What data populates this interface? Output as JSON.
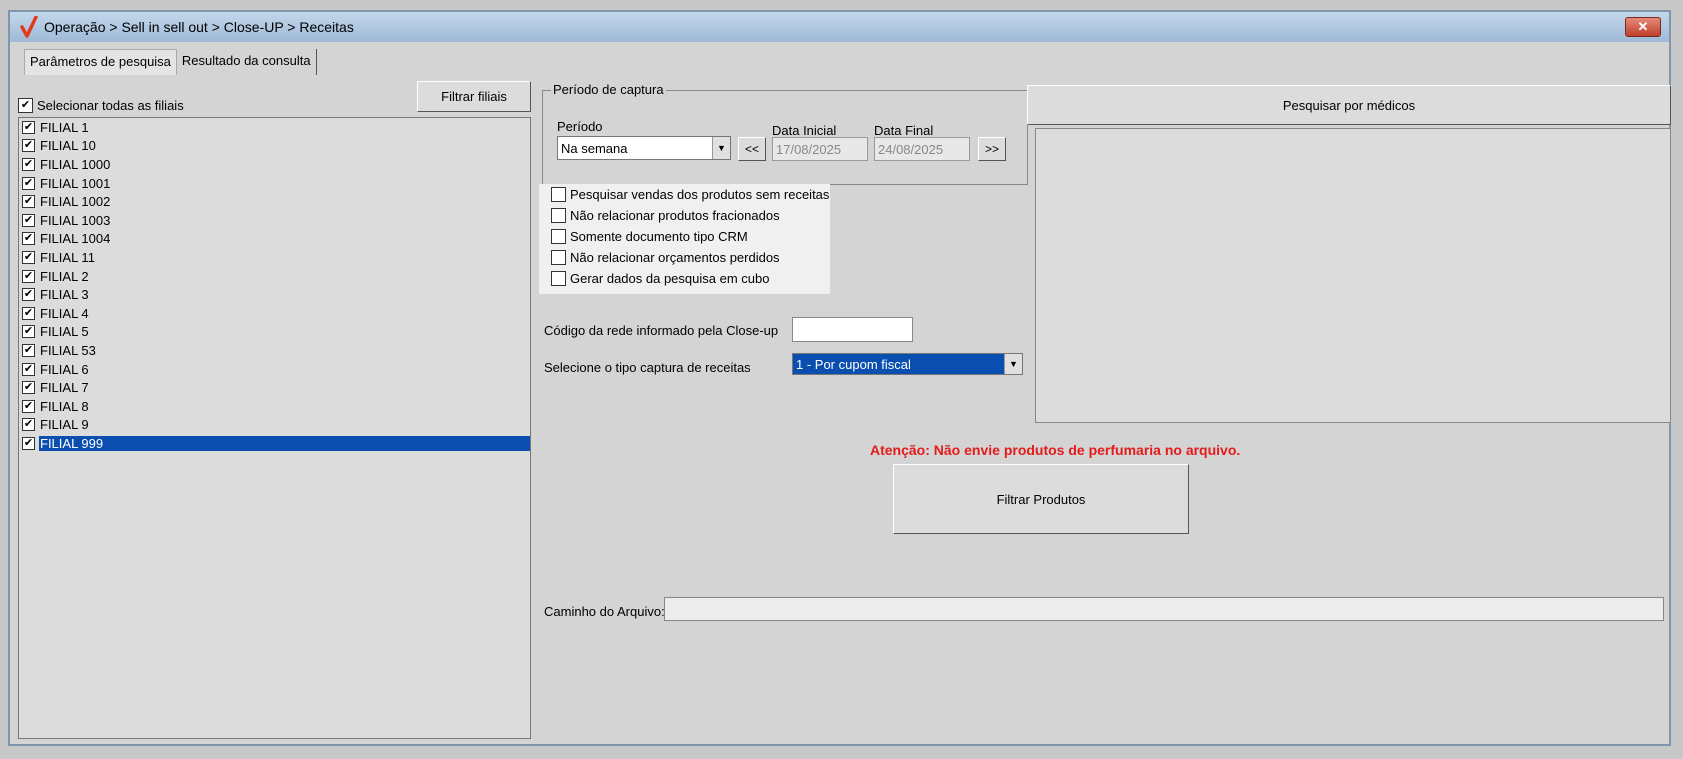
{
  "window": {
    "title": "Operação > Sell in sell out > Close-UP > Receitas",
    "close_symbol": "✕",
    "logo_symbol": "✓",
    "logo_color": "#e03c1c"
  },
  "tabs": [
    {
      "label": "Parâmetros de pesquisa",
      "active": true
    },
    {
      "label": "Resultado da consulta",
      "active": false
    }
  ],
  "branches": {
    "select_all_label": "Selecionar todas as filiais",
    "select_all_checked": true,
    "filter_button_label": "Filtrar filiais",
    "items": [
      {
        "label": "FILIAL 1",
        "checked": true
      },
      {
        "label": "FILIAL 10",
        "checked": true
      },
      {
        "label": "FILIAL 1000",
        "checked": true
      },
      {
        "label": "FILIAL 1001",
        "checked": true
      },
      {
        "label": "FILIAL 1002",
        "checked": true
      },
      {
        "label": "FILIAL 1003",
        "checked": true
      },
      {
        "label": "FILIAL 1004",
        "checked": true
      },
      {
        "label": "FILIAL 11",
        "checked": true
      },
      {
        "label": "FILIAL 2",
        "checked": true
      },
      {
        "label": "FILIAL 3",
        "checked": true
      },
      {
        "label": "FILIAL 4",
        "checked": true
      },
      {
        "label": "FILIAL 5",
        "checked": true
      },
      {
        "label": "FILIAL 53",
        "checked": true
      },
      {
        "label": "FILIAL 6",
        "checked": true
      },
      {
        "label": "FILIAL 7",
        "checked": true
      },
      {
        "label": "FILIAL 8",
        "checked": true
      },
      {
        "label": "FILIAL 9",
        "checked": true
      },
      {
        "label": "FILIAL 999",
        "checked": true,
        "selected": true
      }
    ]
  },
  "capture_period": {
    "group_label": "Período de captura",
    "period_label": "Período",
    "period_value": "Na semana",
    "prev_button": "<<",
    "next_button": ">>",
    "start_label": "Data Inicial",
    "start_value": "17/08/2025",
    "end_label": "Data Final",
    "end_value": "24/08/2025"
  },
  "options": [
    {
      "label": "Pesquisar vendas dos produtos sem receitas",
      "checked": false
    },
    {
      "label": "Não relacionar produtos fracionados",
      "checked": false
    },
    {
      "label": "Somente documento tipo CRM",
      "checked": false
    },
    {
      "label": "Não relacionar orçamentos perdidos",
      "checked": false
    },
    {
      "label": "Gerar dados da pesquisa em cubo",
      "checked": false
    }
  ],
  "network_code": {
    "label": "Código da rede informado pela Close-up",
    "value": ""
  },
  "capture_type": {
    "label": "Selecione o tipo captura de receitas",
    "value": "1 - Por cupom fiscal"
  },
  "doctors": {
    "button_label": "Pesquisar por médicos"
  },
  "warning": {
    "text": "Atenção: Não envie produtos de perfumaria no arquivo.",
    "color": "#e31b1b"
  },
  "filter_products_label": "Filtrar Produtos",
  "file_path": {
    "label": "Caminho do Arquivo:",
    "value": ""
  },
  "colors": {
    "selection": "#0a4fb0",
    "title_bar": "#a9c2dc"
  }
}
